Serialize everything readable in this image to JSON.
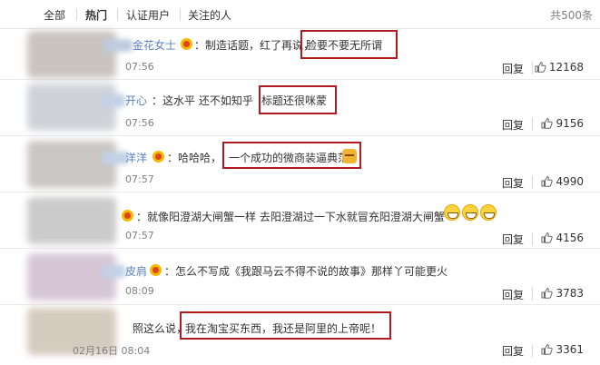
{
  "tabs": [
    "全部",
    "热门",
    "认证用户",
    "关注的人"
  ],
  "total": "共500条",
  "reply_label": "回复",
  "comments": [
    {
      "name": "金花女士",
      "text_a": "：制造话题，红了再说，",
      "text_hl": "脸要不要无所谓",
      "time": "07:56",
      "likes": "12168"
    },
    {
      "name": "开心",
      "text_a": "：这水平 还不如知乎 ",
      "text_hl": "标题还很咪蒙",
      "time": "07:56",
      "likes": "9156"
    },
    {
      "name": "洋洋",
      "text_a": "：哈哈哈，",
      "text_hl": "一个成功的微商装逼典范",
      "time": "07:57",
      "likes": "4990"
    },
    {
      "name": "",
      "text_a": "：就像阳澄湖大闸蟹一样 去阳澄湖过一下水就冒充阳澄湖大闸蟹",
      "text_hl": "",
      "time": "07:57",
      "likes": "4156"
    },
    {
      "name": "皮肩",
      "text_a": "：怎么不写成《我跟马云不得不说的故事》那样丫可能更火",
      "text_hl": "",
      "time": "08:09",
      "likes": "3783"
    },
    {
      "name": "",
      "text_a": "照这么说，",
      "text_hl": "我在淘宝买东西，我还是阿里的上帝呢！",
      "time": "02月16日 08:04",
      "likes": "3361"
    }
  ]
}
